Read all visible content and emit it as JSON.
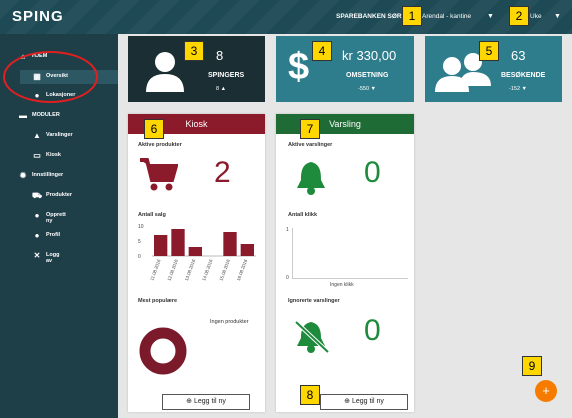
{
  "app": {
    "logo": "SPING"
  },
  "header": {
    "bank": "SPAREBANKEN SØR",
    "location": "Arendal - kantine",
    "period": "Uke"
  },
  "sidebar": {
    "sections": [
      {
        "label": "HJEM",
        "icon": "home-icon"
      },
      {
        "label": "Oversikt",
        "icon": "dashboard-icon"
      },
      {
        "label": "Lokasjoner",
        "icon": "map-pin-icon"
      },
      {
        "label": "MODULER",
        "icon": "modules-icon"
      },
      {
        "label": "Varslinger",
        "icon": "bell-icon"
      },
      {
        "label": "Kiosk",
        "icon": "store-icon"
      },
      {
        "label": "Innstillinger",
        "icon": "gear-icon"
      },
      {
        "label": "Produkter",
        "icon": "cart-icon"
      },
      {
        "label": "Opprett ny",
        "icon": "pin-icon"
      },
      {
        "label": "Profil",
        "icon": "user-icon"
      },
      {
        "label": "Logg av",
        "icon": "close-icon"
      }
    ]
  },
  "cards": {
    "spingers": {
      "value": "8",
      "label": "SPINGERS",
      "delta": "8"
    },
    "omsetning": {
      "value": "kr 330,00",
      "label": "OMSETNING",
      "delta": "-550"
    },
    "besokende": {
      "value": "63",
      "label": "BESØKENDE",
      "delta": "-152"
    }
  },
  "kiosk": {
    "title": "Kiosk",
    "active_label": "Aktive produkter",
    "active_value": "2",
    "sales_label": "Antall salg",
    "popular_label": "Mest populære",
    "popular_empty": "Ingen produkter",
    "add_label": "Legg til ny",
    "sales": {
      "yticks": [
        "10",
        "5",
        "0"
      ],
      "dates": [
        "11.08.2016",
        "12.08.2016",
        "13.08.2016",
        "14.08.2016",
        "15.08.2016",
        "16.08.2016"
      ]
    }
  },
  "varsling": {
    "title": "Varsling",
    "active_label": "Aktive varslinger",
    "active_value": "0",
    "clicks_label": "Antall klikk",
    "clicks_empty": "Ingen klikk",
    "ignored_label": "Ignorerte varslinger",
    "ignored_value": "0",
    "add_label": "Legg til ny",
    "clicks_y": [
      "1",
      "0"
    ]
  },
  "badges": [
    "1",
    "2",
    "3",
    "4",
    "5",
    "6",
    "7",
    "8",
    "9"
  ],
  "fab": {
    "label": "+"
  },
  "colors": {
    "kiosk": "#8b1a2b",
    "varsling": "#1e6b36",
    "teal": "#2e7d8c",
    "dark": "#1d4a55"
  },
  "chart_data": {
    "type": "bar",
    "categories": [
      "11.08.2016",
      "12.08.2016",
      "13.08.2016",
      "14.08.2016",
      "15.08.2016",
      "16.08.2016"
    ],
    "values": [
      7,
      9,
      3,
      0,
      8,
      4
    ],
    "ylim": [
      0,
      10
    ]
  }
}
